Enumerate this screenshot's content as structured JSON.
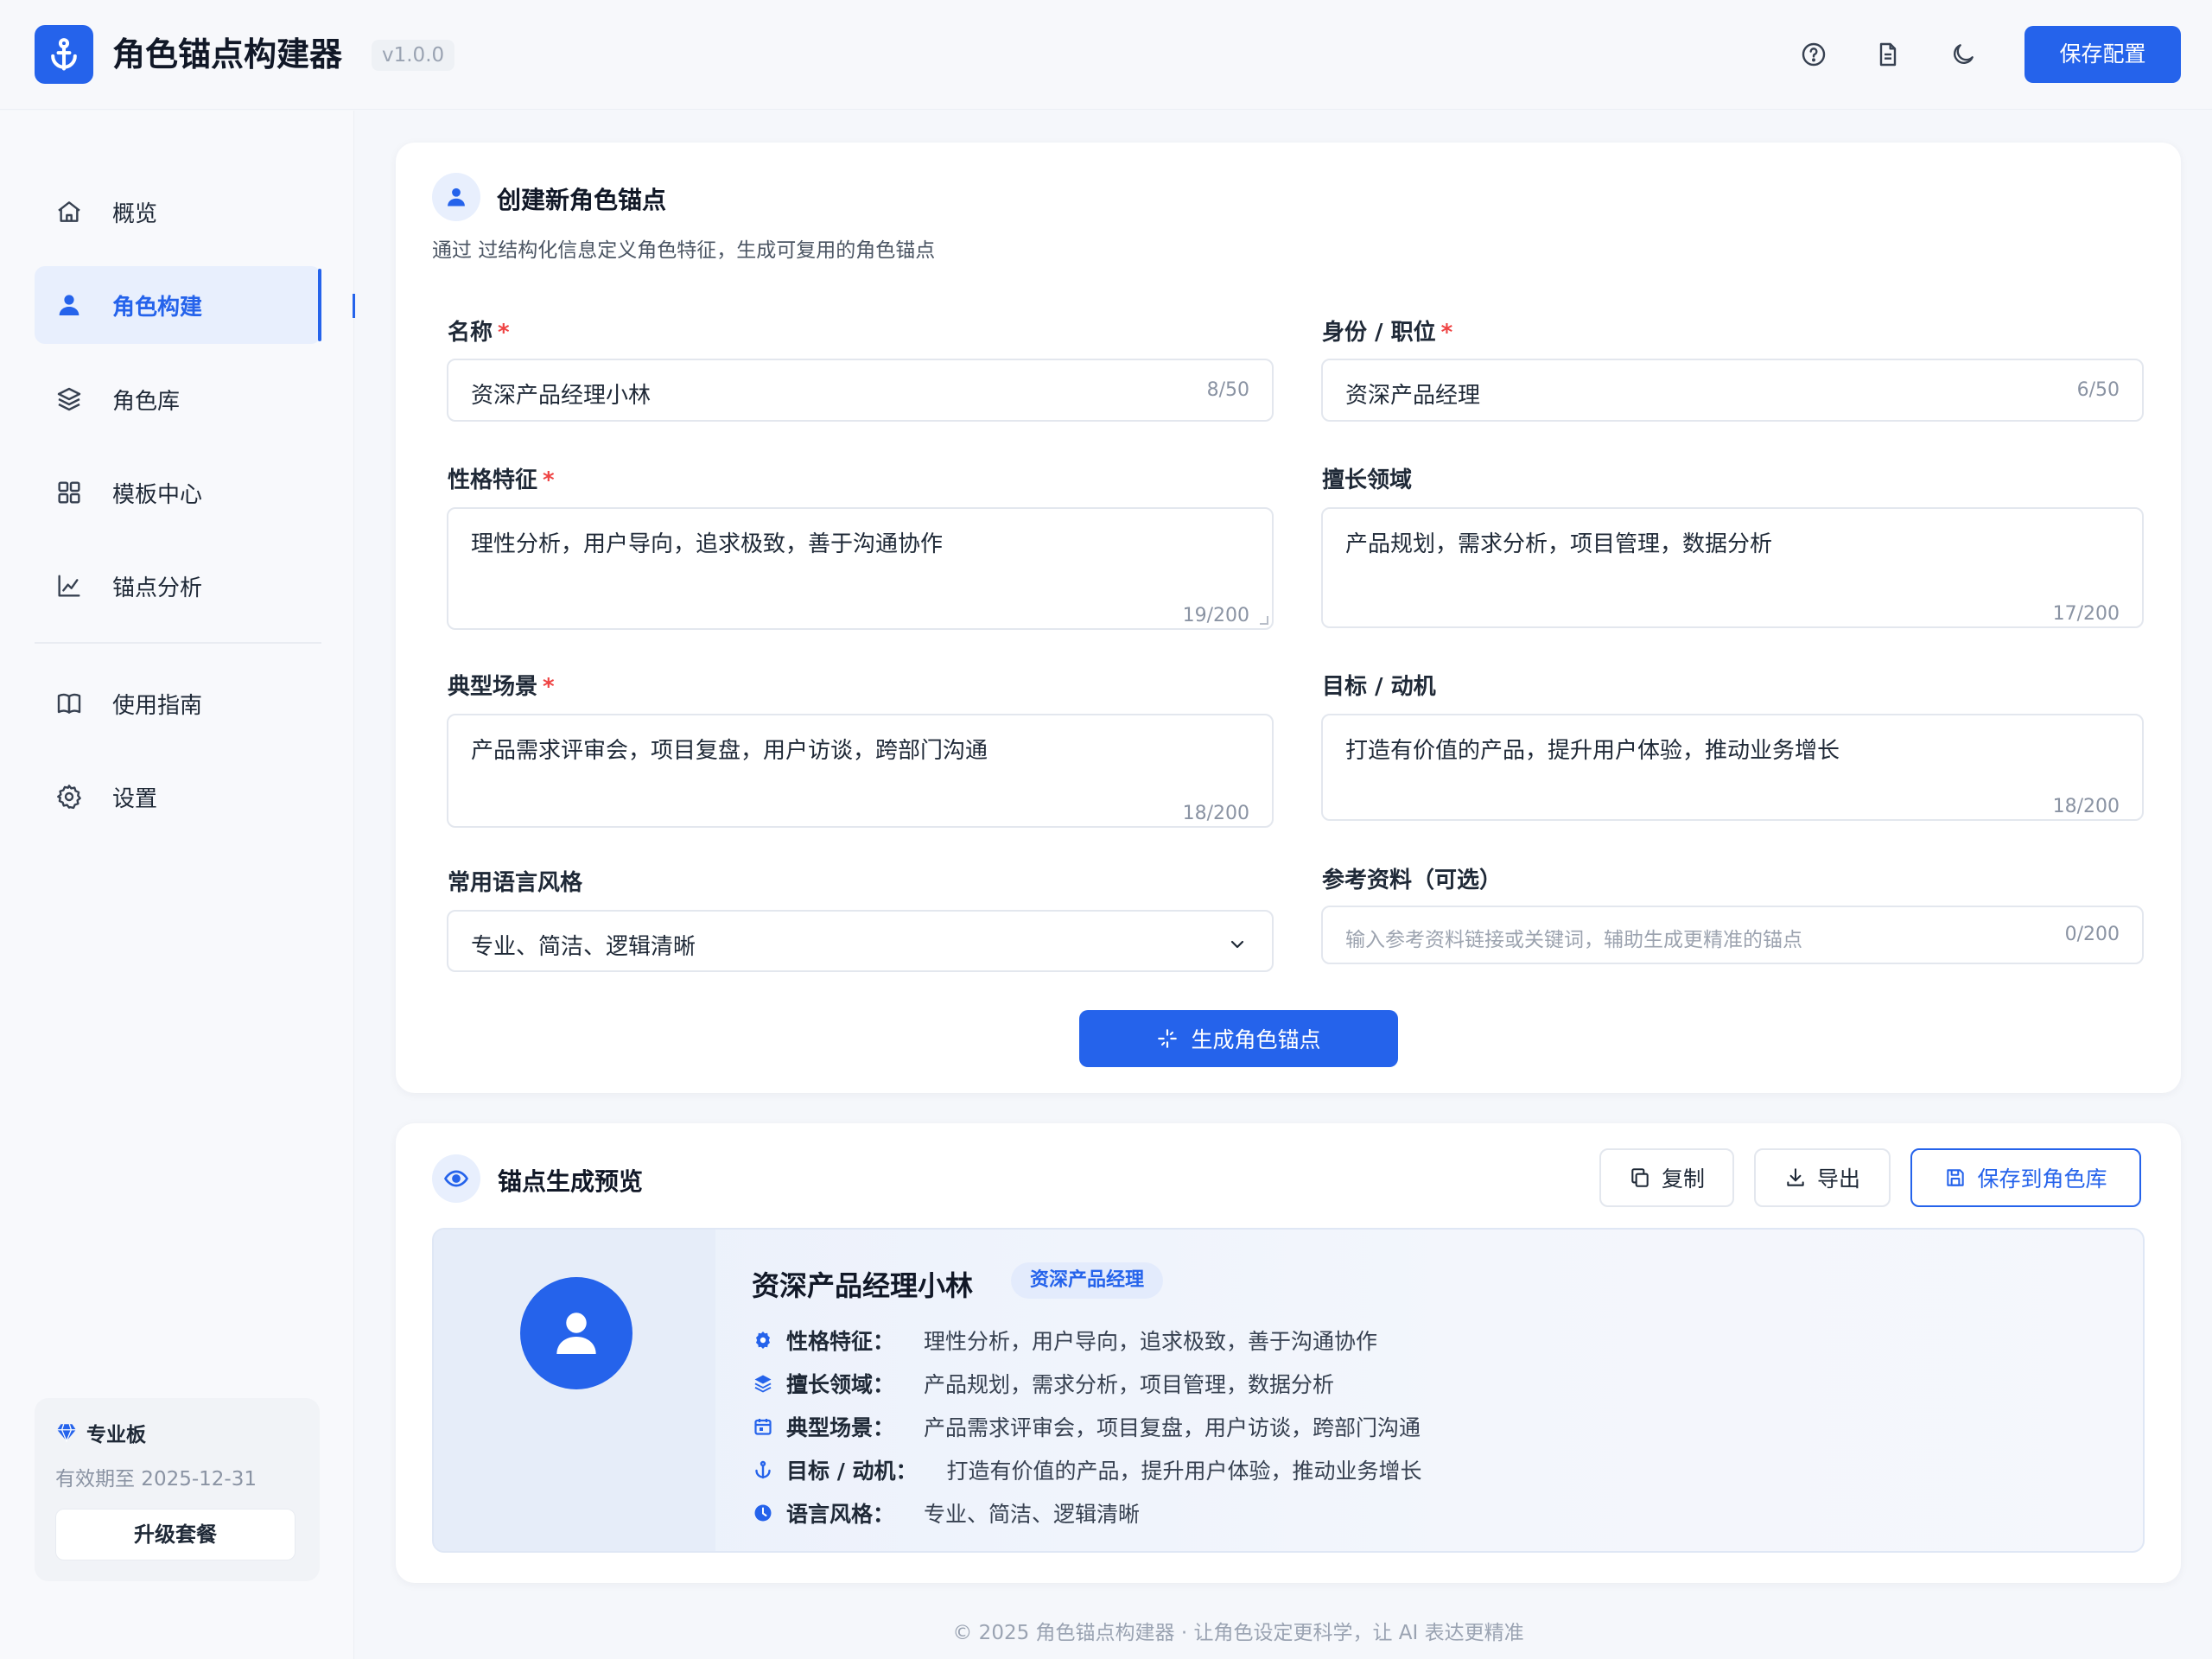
{
  "header": {
    "title": "角色锚点构建器",
    "version": "v1.0.0",
    "icons": [
      "help-icon",
      "document-icon",
      "moon-icon"
    ],
    "save_label": "保存配置"
  },
  "sidebar": {
    "items": [
      {
        "label": "概览",
        "icon": "home-icon"
      },
      {
        "label": "角色构建",
        "icon": "user-icon",
        "active": true
      },
      {
        "label": "角色库",
        "icon": "layers-icon"
      },
      {
        "label": "模板中心",
        "icon": "grid-icon"
      },
      {
        "label": "锚点分析",
        "icon": "chart-icon"
      },
      {
        "label": "使用指南",
        "icon": "book-icon"
      },
      {
        "label": "设置",
        "icon": "gear-icon"
      }
    ],
    "plan": {
      "name": "专业板",
      "expiry": "有效期至 2025-12-31",
      "upgrade_label": "升级套餐"
    }
  },
  "form": {
    "title": "创建新角色锚点",
    "subtitle": "通过  过结构化信息定义角色特征，生成可复用的角色锚点",
    "name": {
      "label": "名称",
      "value": "资深产品经理小林",
      "count": "8/50"
    },
    "identity": {
      "label": "身份 / 职位",
      "value": "资深产品经理",
      "count": "6/50"
    },
    "personality": {
      "label": "性格特征",
      "value": "理性分析，用户导向，追求极致，善于沟通协作",
      "count": "19/200"
    },
    "expertise": {
      "label": "擅长领域",
      "value": "产品规划，需求分析，项目管理，数据分析",
      "count": "17/200"
    },
    "scenarios": {
      "label": "典型场景",
      "value": "产品需求评审会，项目复盘，用户访谈，跨部门沟通",
      "count": "18/200"
    },
    "goals": {
      "label": "目标 / 动机",
      "value": "打造有价值的产品，提升用户体验，推动业务增长",
      "count": "18/200"
    },
    "style": {
      "label": "常用语言风格",
      "value": "专业、简洁、逻辑清晰"
    },
    "reference": {
      "label": "参考资料（可选）",
      "placeholder": "输入参考资料链接或关键词，辅助生成更精准的锚点",
      "count": "0/200"
    },
    "generate_label": "生成角色锚点"
  },
  "preview": {
    "title": "锚点生成预览",
    "copy_label": "复制",
    "export_label": "导出",
    "save_label": "保存到角色库",
    "name": "资深产品经理小林",
    "badge": "资深产品经理",
    "rows": [
      {
        "key": "性格特征：",
        "value": "理性分析，用户导向，追求极致，善于沟通协作",
        "icon": "brain-icon"
      },
      {
        "key": "擅长领域：",
        "value": "产品规划，需求分析，项目管理，数据分析",
        "icon": "layers-icon"
      },
      {
        "key": "典型场景：",
        "value": "产品需求评审会，项目复盘，用户访谈，跨部门沟通",
        "icon": "calendar-icon"
      },
      {
        "key": "目标 / 动机：",
        "value": "打造有价值的产品，提升用户体验，推动业务增长",
        "icon": "target-icon"
      },
      {
        "key": "语言风格：",
        "value": "专业、简洁、逻辑清晰",
        "icon": "chat-icon"
      }
    ]
  },
  "footer": "© 2025 角色锚点构建器 · 让角色设定更科学，让 AI 表达更精准",
  "colors": {
    "accent": "#2563eb",
    "required": "#ef4444",
    "background": "#f5f7fb"
  }
}
